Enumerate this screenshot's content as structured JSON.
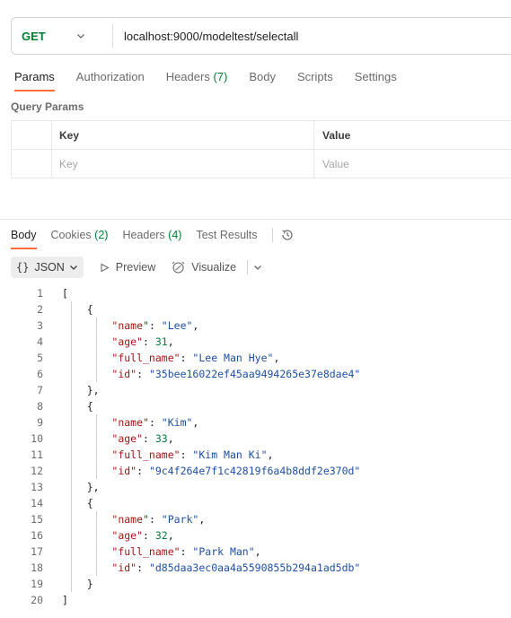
{
  "request": {
    "method": "GET",
    "url": "localhost:9000/modeltest/selectall"
  },
  "request_tabs": [
    {
      "label": "Params",
      "count": ""
    },
    {
      "label": "Authorization",
      "count": ""
    },
    {
      "label": "Headers",
      "count": "(7)"
    },
    {
      "label": "Body",
      "count": ""
    },
    {
      "label": "Scripts",
      "count": ""
    },
    {
      "label": "Settings",
      "count": ""
    }
  ],
  "query_params": {
    "title": "Query Params",
    "header_key": "Key",
    "header_value": "Value",
    "placeholder_key": "Key",
    "placeholder_value": "Value"
  },
  "response_tabs": [
    {
      "label": "Body",
      "count": ""
    },
    {
      "label": "Cookies",
      "count": "(2)"
    },
    {
      "label": "Headers",
      "count": "(4)"
    },
    {
      "label": "Test Results",
      "count": ""
    }
  ],
  "toolbar": {
    "format_braces": "{}",
    "format_label": "JSON",
    "preview_label": "Preview",
    "visualize_label": "Visualize"
  },
  "code_lines": [
    {
      "n": "1",
      "text": "["
    },
    {
      "n": "2",
      "text": "    {"
    },
    {
      "n": "3",
      "text": "        \"name\": \"Lee\","
    },
    {
      "n": "4",
      "text": "        \"age\": 31,"
    },
    {
      "n": "5",
      "text": "        \"full_name\": \"Lee Man Hye\","
    },
    {
      "n": "6",
      "text": "        \"id\": \"35bee16022ef45aa9494265e37e8dae4\""
    },
    {
      "n": "7",
      "text": "    },"
    },
    {
      "n": "8",
      "text": "    {"
    },
    {
      "n": "9",
      "text": "        \"name\": \"Kim\","
    },
    {
      "n": "10",
      "text": "        \"age\": 33,"
    },
    {
      "n": "11",
      "text": "        \"full_name\": \"Kim Man Ki\","
    },
    {
      "n": "12",
      "text": "        \"id\": \"9c4f264e7f1c42819f6a4b8ddf2e370d\""
    },
    {
      "n": "13",
      "text": "    },"
    },
    {
      "n": "14",
      "text": "    {"
    },
    {
      "n": "15",
      "text": "        \"name\": \"Park\","
    },
    {
      "n": "16",
      "text": "        \"age\": 32,"
    },
    {
      "n": "17",
      "text": "        \"full_name\": \"Park Man\","
    },
    {
      "n": "18",
      "text": "        \"id\": \"d85daa3ec0aa4a5590855b294a1ad5db\""
    },
    {
      "n": "19",
      "text": "    }"
    },
    {
      "n": "20",
      "text": "]"
    }
  ]
}
